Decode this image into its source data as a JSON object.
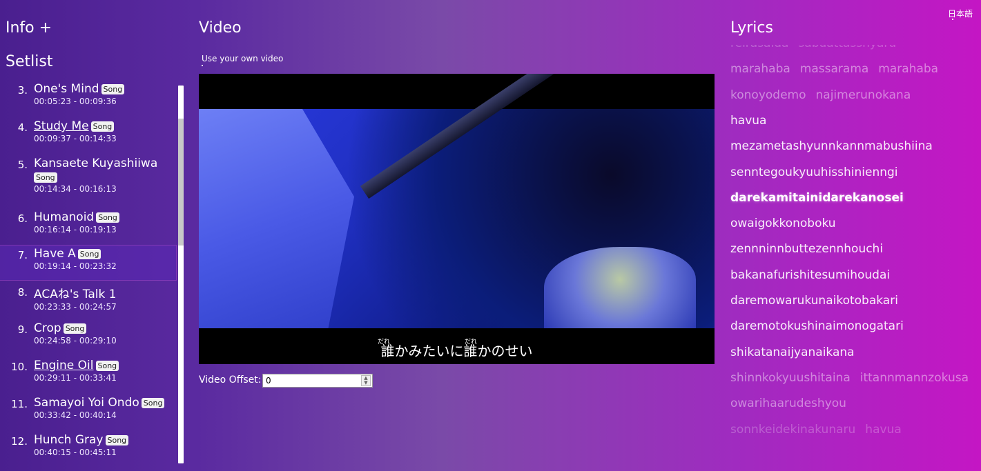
{
  "language_toggle": "日本語",
  "sidebar": {
    "info_heading": "Info +",
    "setlist_heading": "Setlist",
    "songs": [
      {
        "num": "3.",
        "title": "One's Mind",
        "badge": "Song",
        "time": "00:05:23 - 00:09:36",
        "link": false
      },
      {
        "num": "4.",
        "title": "Study Me",
        "badge": "Song",
        "time": "00:09:37 - 00:14:33",
        "link": true
      },
      {
        "num": "5.",
        "title": "Kansaete Kuyashiiwa",
        "badge": "Song",
        "time": "00:14:34 - 00:16:13",
        "link": false
      },
      {
        "num": "6.",
        "title": "Humanoid",
        "badge": "Song",
        "time": "00:16:14 - 00:19:13",
        "link": false
      },
      {
        "num": "7.",
        "title": "Have A",
        "badge": "Song",
        "time": "00:19:14 - 00:23:32",
        "link": false
      },
      {
        "num": "8.",
        "title": "ACAね's Talk 1",
        "badge": "",
        "time": "00:23:33 - 00:24:57",
        "link": false
      },
      {
        "num": "9.",
        "title": "Crop",
        "badge": "Song",
        "time": "00:24:58 - 00:29:10",
        "link": false
      },
      {
        "num": "10.",
        "title": "Engine Oil",
        "badge": "Song",
        "time": "00:29:11 - 00:33:41",
        "link": true
      },
      {
        "num": "11.",
        "title": "Samayoi Yoi Ondo",
        "badge": "Song",
        "time": "00:33:42 - 00:40:14",
        "link": false
      },
      {
        "num": "12.",
        "title": "Hunch Gray",
        "badge": "Song",
        "time": "00:40:15 - 00:45:11",
        "link": false
      }
    ]
  },
  "video": {
    "heading": "Video",
    "own_video_link": "Use your own video",
    "subtitle": "誰かみたいに誰かのせい",
    "ruby_1": "だれ",
    "ruby_2": "だれ",
    "offset_label": "Video Offset:",
    "offset_value": "0"
  },
  "lyrics": {
    "heading": "Lyrics",
    "lines": [
      {
        "words": [
          "reirasaida",
          "sabuattasshyaru"
        ],
        "style": "faint"
      },
      {
        "words": [
          "marahaba",
          "massarama",
          "marahaba"
        ],
        "style": "dim"
      },
      {
        "words": [
          "konoyodemo",
          "najimerunokana"
        ],
        "style": "dim"
      },
      {
        "words": [
          "havua"
        ],
        "style": "normal"
      },
      {
        "words": [
          "mezametashyunnkannmabushiina"
        ],
        "style": "normal"
      },
      {
        "words": [
          "senntegoukyuuhisshinienngi"
        ],
        "style": "normal"
      },
      {
        "words": [
          "darekamitainidarekanosei"
        ],
        "style": "current"
      },
      {
        "words": [
          "owaigokkonoboku"
        ],
        "style": "normal"
      },
      {
        "words": [
          "zennninnbuttezennhouchi"
        ],
        "style": "normal"
      },
      {
        "words": [
          "bakanafurishitesumihoudai"
        ],
        "style": "normal"
      },
      {
        "words": [
          "daremowarukunaikotobakari"
        ],
        "style": "normal"
      },
      {
        "words": [
          "daremotokushinaimonogatari"
        ],
        "style": "normal"
      },
      {
        "words": [
          "shikatanaijyanaikana"
        ],
        "style": "normal"
      },
      {
        "words": [
          "shinnkokyuushitaina",
          "ittannmannzokusa"
        ],
        "style": "dim"
      },
      {
        "words": [
          "owarihaarudeshyou"
        ],
        "style": "dim"
      },
      {
        "words": [
          "sonnkeidekinakunaru",
          "havua"
        ],
        "style": "faint"
      }
    ]
  }
}
